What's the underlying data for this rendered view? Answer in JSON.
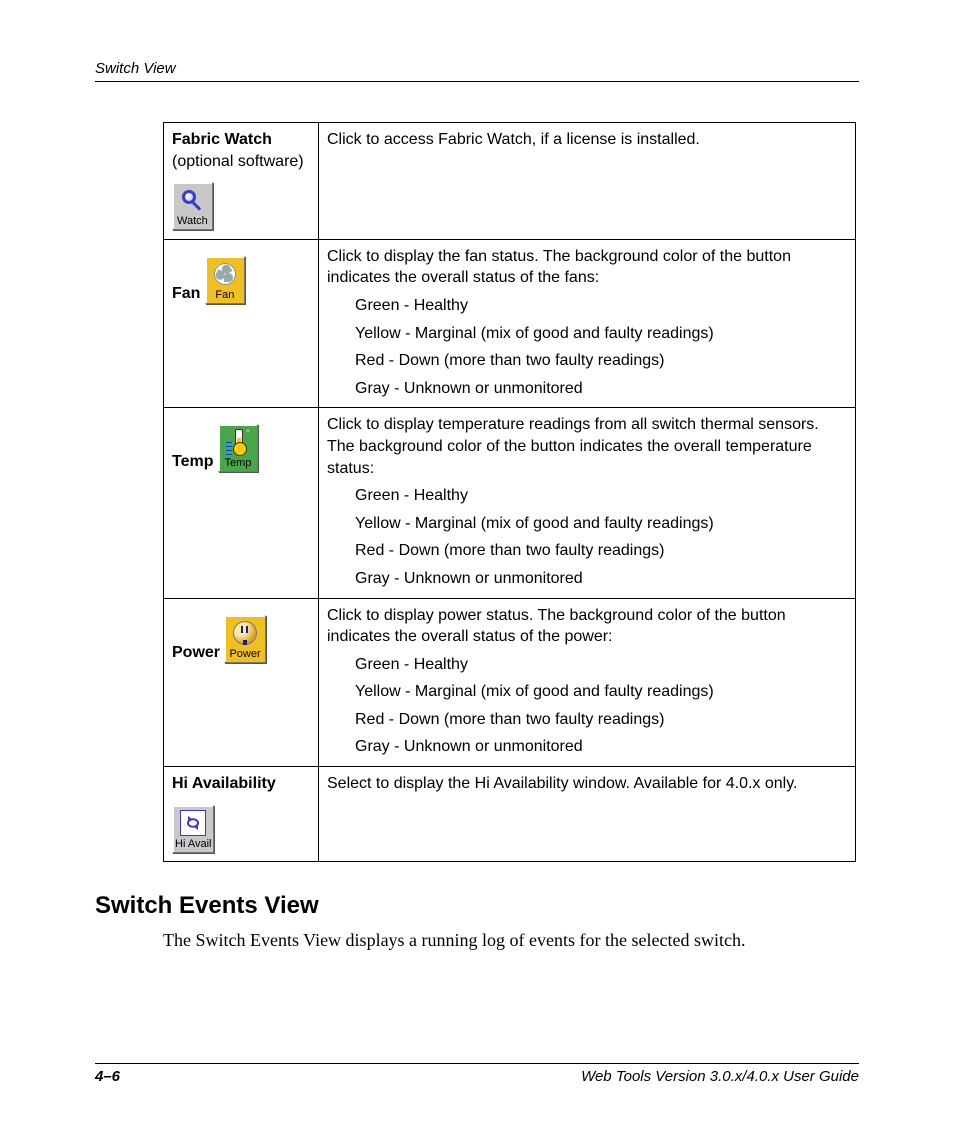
{
  "header": {
    "section": "Switch View"
  },
  "rows": {
    "fabric": {
      "title": "Fabric Watch",
      "subtitle": "(optional software)",
      "iconLabel": "Watch",
      "desc": "Click to access Fabric Watch, if a license is installed."
    },
    "fan": {
      "title": "Fan",
      "iconLabel": "Fan",
      "desc": "Click to display the fan status. The background color of the button indicates the overall status of the fans:",
      "status": [
        "Green - Healthy",
        "Yellow - Marginal (mix of good and faulty readings)",
        "Red - Down (more than two faulty readings)",
        "Gray - Unknown or unmonitored"
      ]
    },
    "temp": {
      "title": "Temp",
      "iconLabel": "Temp",
      "desc": "Click to display temperature readings from all switch thermal sensors. The background color of the button indicates the overall temperature status:",
      "status": [
        "Green - Healthy",
        "Yellow - Marginal (mix of good and faulty readings)",
        "Red - Down (more than two faulty readings)",
        "Gray - Unknown or unmonitored"
      ]
    },
    "power": {
      "title": "Power",
      "iconLabel": "Power",
      "desc": "Click to display power status. The background color of the button indicates the overall status of the power:",
      "status": [
        "Green - Healthy",
        "Yellow - Marginal (mix of good and faulty readings)",
        "Red - Down (more than two faulty readings)",
        "Gray - Unknown or unmonitored"
      ]
    },
    "hiavail": {
      "title": "Hi Availability",
      "iconLabel": "Hi Avail",
      "desc": "Select to display the Hi Availability window. Available for 4.0.x only."
    }
  },
  "section": {
    "heading": "Switch Events View",
    "para": "The Switch Events View displays a running log of events for the selected switch."
  },
  "footer": {
    "page": "4–6",
    "guide": "Web Tools Version 3.0.x/4.0.x User Guide"
  }
}
